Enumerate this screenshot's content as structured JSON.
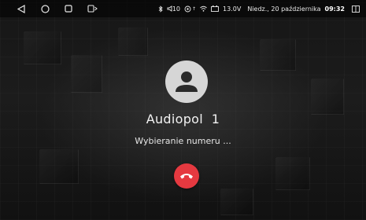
{
  "status_bar": {
    "nav": {
      "back_icon": "back-triangle-icon",
      "home_icon": "home-circle-icon",
      "recents_icon": "recents-square-icon",
      "screen_icon": "screen-mirror-icon"
    },
    "volume_level": "10",
    "voltage": "13.0V",
    "date": "Niedz., 20 października",
    "time": "09:32"
  },
  "call": {
    "caller_name": "Audiopol  1",
    "status": "Wybieranie numeru ...",
    "hangup_icon": "phone-hangup-icon"
  },
  "colors": {
    "hangup": "#e53940",
    "avatar_bg": "#d6d6d6"
  }
}
